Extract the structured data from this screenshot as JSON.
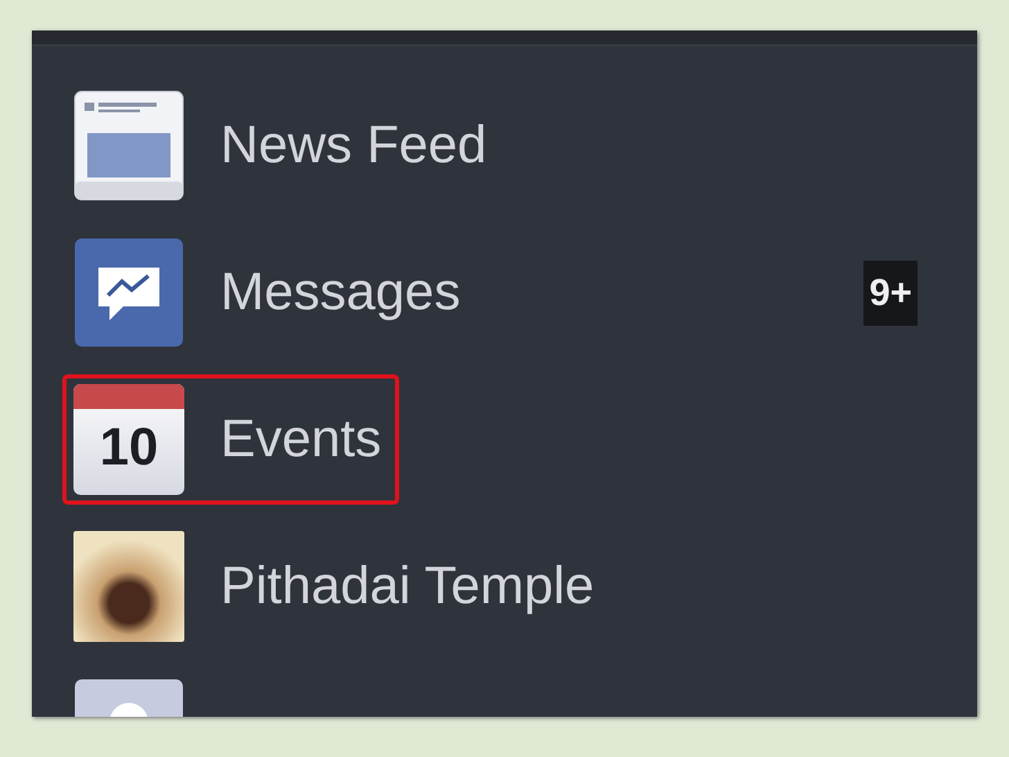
{
  "menu": {
    "items": [
      {
        "kind": "feed",
        "label": "News Feed",
        "highlighted": false
      },
      {
        "kind": "messages",
        "label": "Messages",
        "badge": "9+",
        "highlighted": false
      },
      {
        "kind": "calendar",
        "label": "Events",
        "icon_text": "10",
        "highlighted": true
      },
      {
        "kind": "photo",
        "label": "Pithadai Temple",
        "highlighted": false
      },
      {
        "kind": "partial",
        "highlighted": false
      }
    ]
  }
}
